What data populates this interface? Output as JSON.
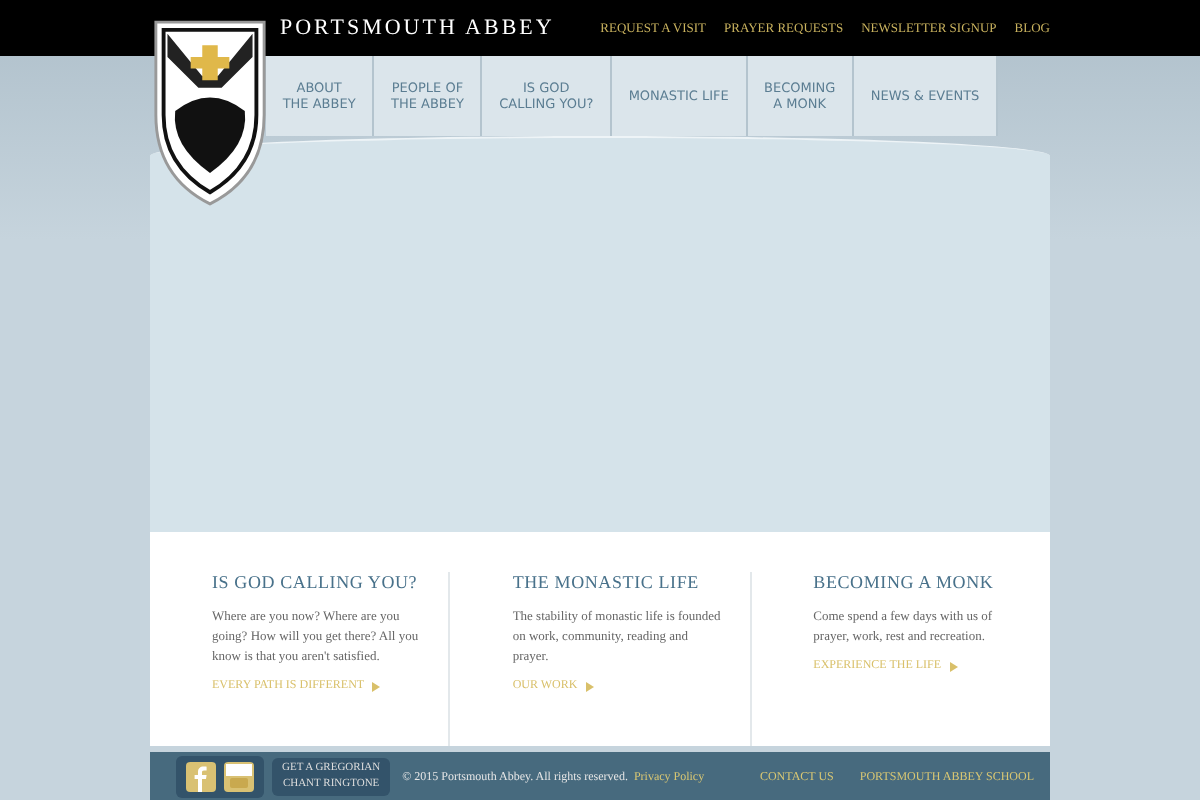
{
  "site_title": "PORTSMOUTH ABBEY",
  "top_links": [
    "REQUEST A VISIT",
    "PRAYER REQUESTS",
    "NEWSLETTER SIGNUP",
    "BLOG"
  ],
  "nav": [
    {
      "label": "ABOUT\nTHE ABBEY",
      "selected": false
    },
    {
      "label": "PEOPLE OF\nTHE ABBEY",
      "selected": false
    },
    {
      "label": "IS GOD\nCALLING YOU?",
      "selected": false
    },
    {
      "label": "MONASTIC LIFE",
      "selected": false
    },
    {
      "label": "BECOMING\nA MONK",
      "selected": false
    },
    {
      "label": "NEWS & EVENTS",
      "selected": false
    }
  ],
  "features": [
    {
      "title": "IS GOD CALLING YOU?",
      "text": "Where are you now?  Where are you going?  How will you get there?  All you know is that you aren't satisfied.",
      "link": "EVERY PATH IS DIFFERENT"
    },
    {
      "title": "THE MONASTIC LIFE",
      "text": "The stability of monastic life is founded on work, community, reading and prayer.",
      "link": "OUR WORK"
    },
    {
      "title": "BECOMING A MONK",
      "text": "Come spend a few days with us of prayer, work, rest and recreation.",
      "link": "EXPERIENCE THE LIFE"
    }
  ],
  "footer": {
    "ringtone": "GET A GREGORIAN\nCHANT RINGTONE",
    "copyright": "© 2015 Portsmouth Abbey. All rights reserved.",
    "privacy": "Privacy Policy",
    "links": [
      "CONTACT US",
      "PORTSMOUTH ABBEY SCHOOL"
    ]
  }
}
